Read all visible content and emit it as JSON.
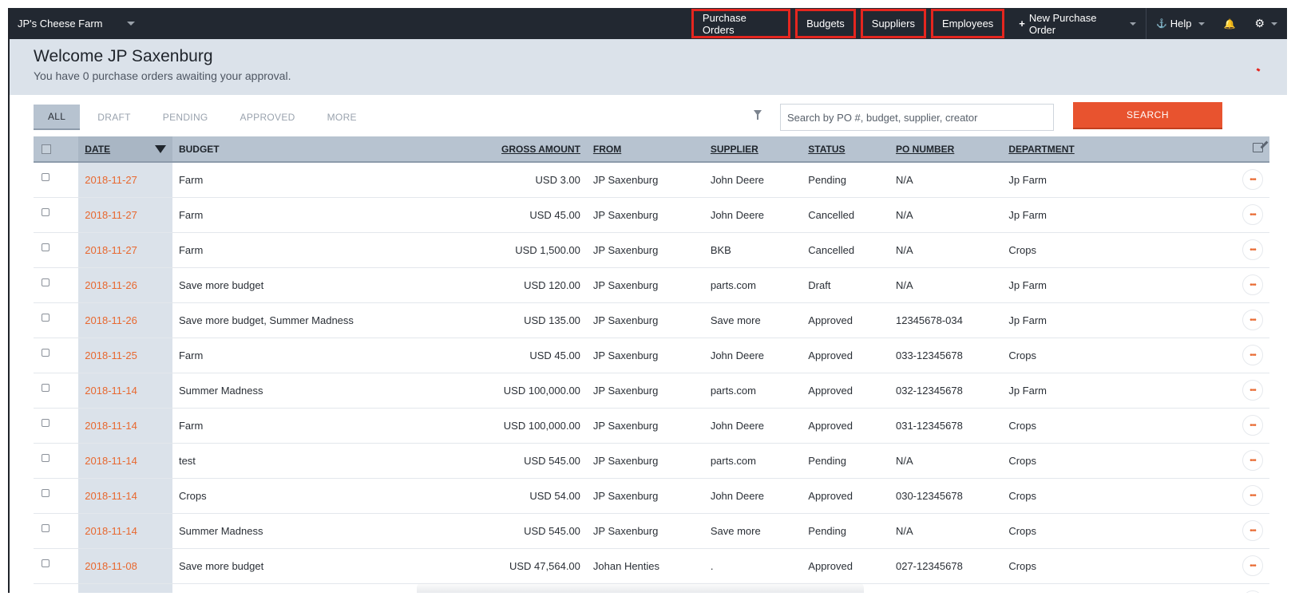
{
  "nav": {
    "brand": "JP's Cheese Farm",
    "links": [
      "Purchase Orders",
      "Budgets",
      "Suppliers",
      "Employees"
    ],
    "new_po": "New Purchase Order",
    "help": "Help"
  },
  "welcome": {
    "title": "Welcome JP Saxenburg",
    "subtitle": "You have 0 purchase orders awaiting your approval."
  },
  "tabs": [
    "ALL",
    "DRAFT",
    "PENDING",
    "APPROVED",
    "MORE"
  ],
  "search": {
    "placeholder": "Search by PO #, budget, supplier, creator",
    "button": "SEARCH"
  },
  "columns": {
    "date": "DATE",
    "budget": "BUDGET",
    "gross": "GROSS AMOUNT",
    "from": "FROM",
    "supplier": "SUPPLIER",
    "status": "STATUS",
    "po": "PO NUMBER",
    "department": "DEPARTMENT"
  },
  "rows": [
    {
      "date": "2018-11-27",
      "budget": "Farm",
      "gross": "USD 3.00",
      "from": "JP Saxenburg",
      "supplier": "John Deere",
      "status": "Pending",
      "po": "N/A",
      "department": "Jp Farm"
    },
    {
      "date": "2018-11-27",
      "budget": "Farm",
      "gross": "USD 45.00",
      "from": "JP Saxenburg",
      "supplier": "John Deere",
      "status": "Cancelled",
      "po": "N/A",
      "department": "Jp Farm"
    },
    {
      "date": "2018-11-27",
      "budget": "Farm",
      "gross": "USD 1,500.00",
      "from": "JP Saxenburg",
      "supplier": "BKB",
      "status": "Cancelled",
      "po": "N/A",
      "department": "Crops"
    },
    {
      "date": "2018-11-26",
      "budget": "Save more budget",
      "gross": "USD 120.00",
      "from": "JP Saxenburg",
      "supplier": "parts.com",
      "status": "Draft",
      "po": "N/A",
      "department": "Jp Farm"
    },
    {
      "date": "2018-11-26",
      "budget": "Save more budget, Summer Madness",
      "gross": "USD 135.00",
      "from": "JP Saxenburg",
      "supplier": "Save more",
      "status": "Approved",
      "po": "12345678-034",
      "department": "Jp Farm"
    },
    {
      "date": "2018-11-25",
      "budget": "Farm",
      "gross": "USD 45.00",
      "from": "JP Saxenburg",
      "supplier": "John Deere",
      "status": "Approved",
      "po": "033-12345678",
      "department": "Crops"
    },
    {
      "date": "2018-11-14",
      "budget": "Summer Madness",
      "gross": "USD 100,000.00",
      "from": "JP Saxenburg",
      "supplier": "parts.com",
      "status": "Approved",
      "po": "032-12345678",
      "department": "Jp Farm"
    },
    {
      "date": "2018-11-14",
      "budget": "Farm",
      "gross": "USD 100,000.00",
      "from": "JP Saxenburg",
      "supplier": "John Deere",
      "status": "Approved",
      "po": "031-12345678",
      "department": "Crops"
    },
    {
      "date": "2018-11-14",
      "budget": "test",
      "gross": "USD 545.00",
      "from": "JP Saxenburg",
      "supplier": "parts.com",
      "status": "Pending",
      "po": "N/A",
      "department": "Crops"
    },
    {
      "date": "2018-11-14",
      "budget": "Crops",
      "gross": "USD 54.00",
      "from": "JP Saxenburg",
      "supplier": "John Deere",
      "status": "Approved",
      "po": "030-12345678",
      "department": "Crops"
    },
    {
      "date": "2018-11-14",
      "budget": "Summer Madness",
      "gross": "USD 545.00",
      "from": "JP Saxenburg",
      "supplier": "Save more",
      "status": "Pending",
      "po": "N/A",
      "department": "Crops"
    },
    {
      "date": "2018-11-08",
      "budget": "Save more budget",
      "gross": "USD 47,564.00",
      "from": "Johan Henties",
      "supplier": ".",
      "status": "Approved",
      "po": "027-12345678",
      "department": "Crops"
    },
    {
      "date": "",
      "budget": "",
      "gross": "",
      "from": "",
      "supplier": "",
      "status": "",
      "po": "",
      "department": ""
    }
  ],
  "colors": {
    "accent": "#e8532f",
    "nav_bg": "#222831",
    "highlight_border": "#e5261f",
    "header_bg": "#b7c3d0"
  }
}
